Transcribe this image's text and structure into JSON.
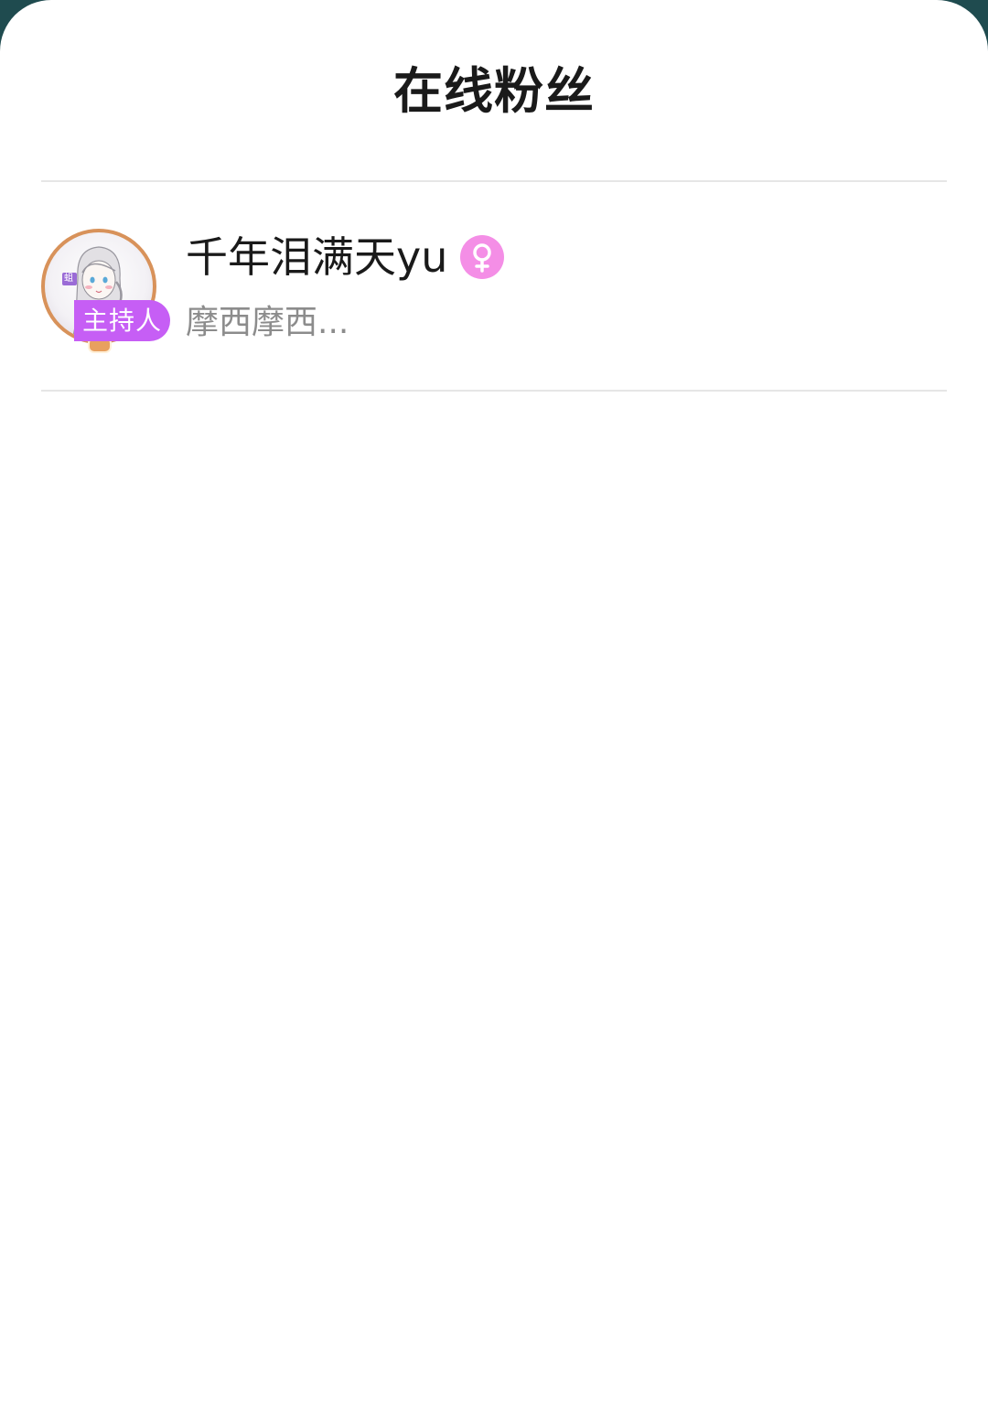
{
  "sheet": {
    "title": "在线粉丝"
  },
  "fans": [
    {
      "name": "千年泪满天yu",
      "subtitle": "摩西摩西...",
      "role_badge": "主持人",
      "avatar_tag": "蛆",
      "gender_icon": "female-icon",
      "gender_color": "#f48ee6",
      "badge_color": "#c65ef5",
      "frame_color": "#d8925a"
    }
  ]
}
